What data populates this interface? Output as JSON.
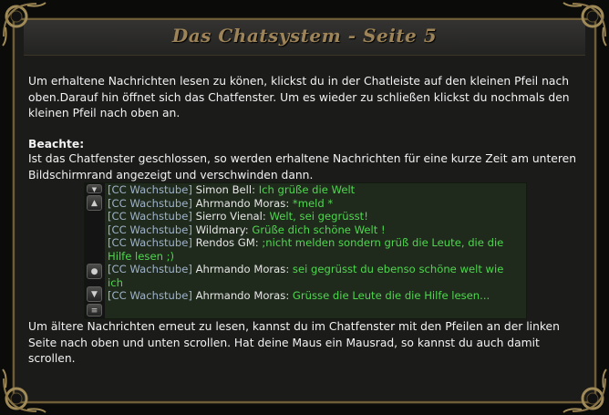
{
  "window": {
    "title": "Das Chatsystem - Seite 5"
  },
  "paragraphs": {
    "intro": "Um erhaltene Nachrichten lesen zu könen, klickst du in der Chatleiste auf den kleinen Pfeil nach oben.Darauf hin öffnet sich das Chatfenster. Um es wieder zu schließen klickst du nochmals den kleinen Pfeil nach oben an.",
    "note_title": "Beachte:",
    "note": "Ist das Chatfenster geschlossen, so werden erhaltene Nachrichten für eine kurze Zeit am unteren Bildschirmrand angezeigt und verschwinden dann.",
    "scroll": "Um ältere Nachrichten erneut zu lesen, kannst du im Chatfenster mit den Pfeilen an der linken Seite nach oben und unten scrollen. Hat deine Maus ein Mausrad, so kannst du auch damit scrollen."
  },
  "chat": {
    "buttons": {
      "scroll_top": "▼",
      "scroll_up": "▲",
      "middle": "●",
      "scroll_down": "▼",
      "bottom": "≡"
    },
    "lines": [
      {
        "tag": "[CC Wachstube]",
        "name": "Simon Bell",
        "msg": "Ich grüße die Welt"
      },
      {
        "tag": "[CC Wachstube]",
        "name": "Ahrmando Moras",
        "msg": "*meld *"
      },
      {
        "tag": "[CC Wachstube]",
        "name": "Sierro Vienal",
        "msg": "Welt, sei gegrüsst!"
      },
      {
        "tag": "[CC Wachstube]",
        "name": "Wildmary",
        "msg": "Grüße dich schöne Welt !"
      },
      {
        "tag": "[CC Wachstube]",
        "name": "Rendos GM",
        "msg": ";nicht melden sondern grüß die Leute, die die Hilfe lesen ;)"
      },
      {
        "tag": "[CC Wachstube]",
        "name": "Ahrmando Moras",
        "msg": "sei gegrüsst du ebenso schöne welt wie ich"
      },
      {
        "tag": "[CC Wachstube]",
        "name": "Ahrmando Moras",
        "msg": "Grüsse die Leute die die Hilfe lesen..."
      }
    ]
  },
  "colors": {
    "background": "#1b1b1a",
    "border": "#6e5d36",
    "title": "#9d8358",
    "chat_bg": "#1f2a1c",
    "chat_message": "#4fd64f"
  }
}
